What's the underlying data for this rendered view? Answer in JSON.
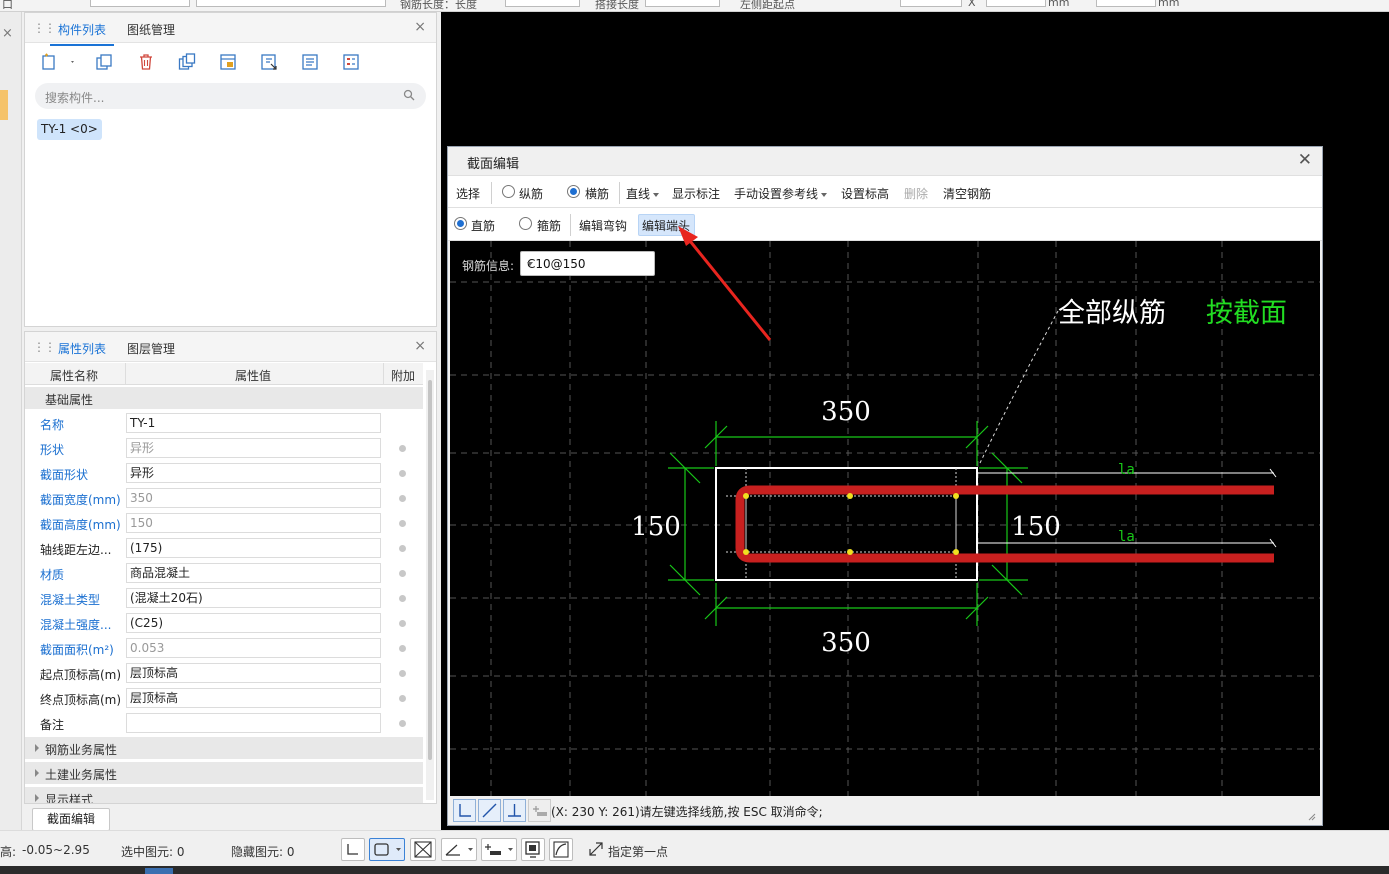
{
  "topbar": {
    "items": [
      "钢筋长度：长度",
      "搭接长度",
      "左侧距起点",
      "左侧距",
      "X",
      "mm",
      "mm"
    ]
  },
  "component_panel": {
    "tabs": [
      "构件列表",
      "图纸管理"
    ],
    "search_placeholder": "搜索构件...",
    "selected_item": "TY-1 <0>"
  },
  "property_panel": {
    "tabs": [
      "属性列表",
      "图层管理"
    ],
    "columns": [
      "属性名称",
      "属性值",
      "附加"
    ],
    "groups": {
      "basic": "基础属性",
      "rebar": "钢筋业务属性",
      "civil": "土建业务属性",
      "display": "显示样式"
    },
    "rows": [
      {
        "name": "名称",
        "value": "TY-1"
      },
      {
        "name": "形状",
        "value": "异形"
      },
      {
        "name": "截面形状",
        "value": "异形"
      },
      {
        "name": "截面宽度(mm)",
        "value": "350"
      },
      {
        "name": "截面高度(mm)",
        "value": "150"
      },
      {
        "name": "轴线距左边...",
        "value": "(175)"
      },
      {
        "name": "材质",
        "value": "商品混凝土"
      },
      {
        "name": "混凝土类型",
        "value": "(混凝土20石)"
      },
      {
        "name": "混凝土强度...",
        "value": "(C25)"
      },
      {
        "name": "截面面积(m²)",
        "value": "0.053"
      },
      {
        "name": "起点顶标高(m)",
        "value": "层顶标高"
      },
      {
        "name": "终点顶标高(m)",
        "value": "层顶标高"
      },
      {
        "name": "备注",
        "value": ""
      }
    ],
    "section_edit_button": "截面编辑"
  },
  "statusbar": {
    "elevation_label": "高:",
    "elevation_value": "-0.05~2.95",
    "selected": "选中图元: 0",
    "hidden": "隐藏图元: 0",
    "prompt": "指定第一点"
  },
  "dialog": {
    "title": "截面编辑",
    "toolbar1": {
      "select": "选择",
      "longitudinal": "纵筋",
      "transverse": "横筋",
      "line": "直线",
      "show_dim": "显示标注",
      "manual_ref": "手动设置参考线",
      "set_elev": "设置标高",
      "delete": "删除",
      "clear": "清空钢筋"
    },
    "toolbar2": {
      "straight": "直筋",
      "stirrup": "箍筋",
      "edit_hook": "编辑弯钩",
      "edit_end": "编辑端头"
    },
    "rebar_info_label": "钢筋信息:",
    "rebar_info_value": "C10@150",
    "drawing": {
      "all_long_bars": "全部纵筋",
      "by_section": "按截面",
      "dim_top": "350",
      "dim_bottom": "350",
      "dim_left": "150",
      "dim_right": "150",
      "la_top": "la",
      "la_bottom": "la"
    },
    "status_message": "(X: 230 Y: 261)请左键选择线筋,按 ESC 取消命令;"
  },
  "colors": {
    "accent": "#1a73d6",
    "rebar": "#c8201f",
    "dim": "#18c818",
    "annotation_green": "#22dd22"
  }
}
